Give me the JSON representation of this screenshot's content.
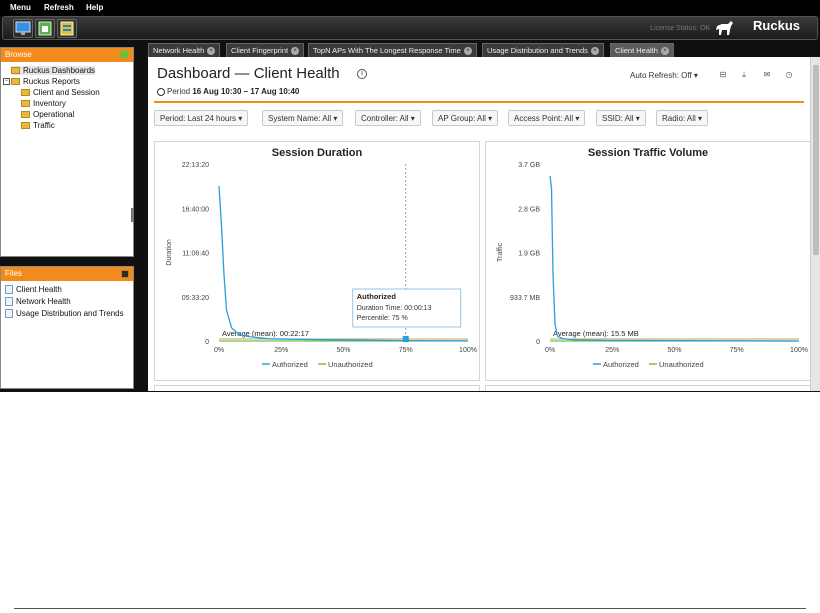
{
  "menu": {
    "items": [
      "Menu",
      "Refresh",
      "Help"
    ]
  },
  "header": {
    "license_status": "License Status: OK",
    "brand": "Ruckus"
  },
  "browse": {
    "title": "Browse",
    "items": [
      {
        "label": "Ruckus Dashboards",
        "selected": true
      },
      {
        "label": "Ruckus Reports"
      },
      {
        "label": "Client and Session"
      },
      {
        "label": "Inventory"
      },
      {
        "label": "Operational"
      },
      {
        "label": "Traffic"
      }
    ]
  },
  "files": {
    "title": "Files",
    "items": [
      "Client Health",
      "Network Health",
      "Usage Distribution and Trends"
    ]
  },
  "tabs": [
    {
      "label": "Network Health"
    },
    {
      "label": "Client Fingerprint"
    },
    {
      "label": "TopN APs With The Longest Response Time"
    },
    {
      "label": "Usage Distribution and Trends"
    },
    {
      "label": "Client Health",
      "active": true
    }
  ],
  "dashboard": {
    "title": "Dashboard — Client Health",
    "period_prefix": "Period",
    "period_value": "16 Aug 10:30 – 17 Aug 10:40",
    "auto_refresh": "Auto Refresh: Off ▾",
    "filters": [
      "Period: Last 24 hours ▾",
      "System Name: All ▾",
      "Controller: All ▾",
      "AP Group: All ▾",
      "Access Point: All ▾",
      "SSID: All ▾",
      "Radio: All ▾"
    ]
  },
  "colors": {
    "accent": "#f38a1c",
    "authorized": "#2a9fd6",
    "unauthorized": "#7cbf4a",
    "average": "#9a8c30"
  },
  "chart_data": [
    {
      "type": "line",
      "title": "Session Duration",
      "ylabel": "Duration",
      "xlabel": "",
      "x_ticks": [
        "0%",
        "25%",
        "50%",
        "75%",
        "100%"
      ],
      "y_ticks": [
        "0",
        "05:33:20",
        "11:06:40",
        "16:40:00",
        "22:13:20"
      ],
      "series": [
        {
          "name": "Authorized",
          "x": [
            0,
            1,
            2,
            3,
            5,
            8,
            12,
            20,
            40,
            75,
            100
          ],
          "y": [
            70,
            52,
            30,
            14,
            6,
            3,
            2,
            1,
            0.6,
            0.2,
            0.05
          ]
        },
        {
          "name": "Unauthorized",
          "x": [
            0,
            100
          ],
          "y": [
            0,
            0
          ]
        }
      ],
      "average_label": "Average (mean): 00:22:17",
      "tooltip": {
        "title": "Authorized",
        "line1": "Duration Time: 00:00:13",
        "line2": "Percentile: 75 %"
      },
      "legend": [
        "Authorized",
        "Unauthorized"
      ]
    },
    {
      "type": "line",
      "title": "Session Traffic Volume",
      "ylabel": "Traffic",
      "xlabel": "",
      "x_ticks": [
        "0%",
        "25%",
        "50%",
        "75%",
        "100%"
      ],
      "y_ticks": [
        "0",
        "933.7 MB",
        "1.9 GB",
        "2.8 GB",
        "3.7 GB"
      ],
      "series": [
        {
          "name": "Authorized",
          "x": [
            0,
            0.6,
            1.2,
            2,
            3,
            5,
            10,
            25,
            100
          ],
          "y": [
            3.45,
            3.2,
            1.4,
            0.35,
            0.1,
            0.05,
            0.02,
            0.01,
            0.0
          ]
        },
        {
          "name": "Unauthorized",
          "x": [
            0,
            100
          ],
          "y": [
            0,
            0
          ]
        }
      ],
      "average_label": "Average (mean): 15.5 MB",
      "legend": [
        "Authorized",
        "Unauthorized"
      ]
    }
  ]
}
